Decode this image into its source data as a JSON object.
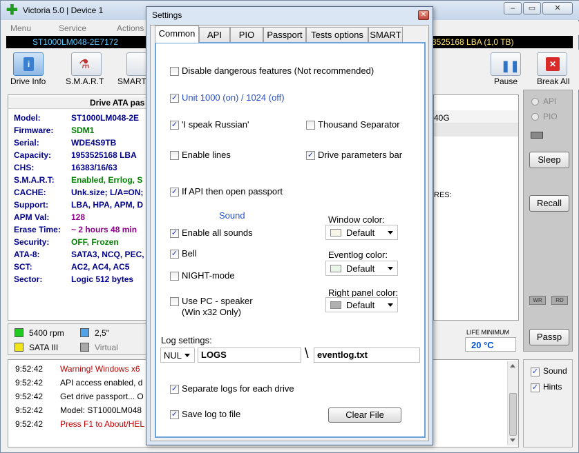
{
  "app": {
    "title": "Victoria 5.0 | Device 1",
    "menu": [
      "Menu",
      "Service",
      "Actions"
    ],
    "drive_bar": {
      "model": "ST1000LM048-2E7172",
      "capacity": "3525168 LBA (1,0 TB)"
    },
    "toolbar": {
      "drive_info": "Drive Info",
      "smart": "S.M.A.R.T",
      "smart2": "SMART",
      "pause": "Pause",
      "break_all": "Break All"
    },
    "info_header": "Drive ATA pas",
    "info": [
      {
        "label": "Model:",
        "value": "ST1000LM048-2E",
        "color": "#00008b"
      },
      {
        "label": "Firmware:",
        "value": "SDM1",
        "color": "#008000"
      },
      {
        "label": "Serial:",
        "value": "WDE4S9TB",
        "color": "#00008b"
      },
      {
        "label": "Capacity:",
        "value": "1953525168 LBA",
        "color": "#00008b"
      },
      {
        "label": "CHS:",
        "value": "16383/16/63",
        "color": "#00008b"
      },
      {
        "label": "S.M.A.R.T:",
        "value": "Enabled, Errlog, S",
        "color": "#008000"
      },
      {
        "label": "CACHE:",
        "value": "Unk.size; L/A=ON;",
        "color": "#00008b"
      },
      {
        "label": "Support:",
        "value": "LBA, HPA, APM, D",
        "color": "#00008b"
      },
      {
        "label": "APM Val:",
        "value": "128",
        "color": "#8b008b"
      },
      {
        "label": "Erase Time:",
        "value": "~ 2 hours 48 min",
        "color": "#8b008b"
      },
      {
        "label": "Security:",
        "value": "OFF, Frozen",
        "color": "#008000"
      },
      {
        "label": "ATA-8:",
        "value": "SATA3, NCQ, PEC,",
        "color": "#00008b"
      },
      {
        "label": "SCT:",
        "value": "AC2, AC4, AC5",
        "color": "#00008b"
      },
      {
        "label": "Sector:",
        "value": "Logic 512 bytes",
        "color": "#00008b"
      }
    ],
    "legend": {
      "rpm": "5400 rpm",
      "size": "2,5\"",
      "sata": "SATA III",
      "virtual": "Virtual"
    },
    "right_info": {
      "partial": "40G",
      "features": "RES:"
    },
    "life_min": {
      "label": "LIFE MINIMUM",
      "value": "20 °C"
    },
    "right_panel": {
      "api": "API",
      "pio": "PIO",
      "sleep": "Sleep",
      "recall": "Recall",
      "wr": "WR",
      "rd": "RD",
      "passp": "Passp",
      "sound": "Sound",
      "hints": "Hints"
    },
    "log": [
      {
        "time": "9:52:42",
        "msg": "Warning! Windows x6",
        "color": "#c00000"
      },
      {
        "time": "9:52:42",
        "msg": "API access enabled, d",
        "color": "#000000"
      },
      {
        "time": "9:52:42",
        "msg": "Get drive passport... O",
        "color": "#000000"
      },
      {
        "time": "9:52:42",
        "msg": "Model: ST1000LM048",
        "color": "#000000"
      },
      {
        "time": "9:52:42",
        "msg": "Press F1 to About/HEL",
        "color": "#c00000"
      }
    ]
  },
  "dialog": {
    "title": "Settings",
    "tabs": [
      "Common",
      "API",
      "PIO",
      "Passport",
      "Tests options",
      "SMART"
    ],
    "options": {
      "disable_dangerous": "Disable dangerous features (Not recommended)",
      "unit": "Unit 1000 (on) / 1024 (off)",
      "russian": "'I speak Russian'",
      "thousand_sep": "Thousand Separator",
      "enable_lines": "Enable lines",
      "drive_params_bar": "Drive parameters bar",
      "api_passport": "If API then open passport",
      "sound_header": "Sound",
      "enable_sounds": "Enable all sounds",
      "bell": "Bell",
      "night_mode": "NIGHT-mode",
      "pc_speaker": "Use PC - speaker",
      "pc_speaker_note": "(Win x32 Only)",
      "window_color": "Window color:",
      "window_color_val": "Default",
      "eventlog_color": "Eventlog color:",
      "eventlog_color_val": "Default",
      "right_panel_color": "Right panel color:",
      "right_panel_color_val": "Default",
      "log_settings": "Log settings:",
      "log_device": "NUL",
      "log_dir": "LOGS",
      "log_sep": "\\",
      "log_file": "eventlog.txt",
      "separate_logs": "Separate logs for each drive",
      "save_log": "Save log to file",
      "clear_file": "Clear File"
    },
    "colors": {
      "window": "#f8f6e8",
      "eventlog": "#eaf6ea",
      "right_panel": "#b0b0b0"
    }
  }
}
